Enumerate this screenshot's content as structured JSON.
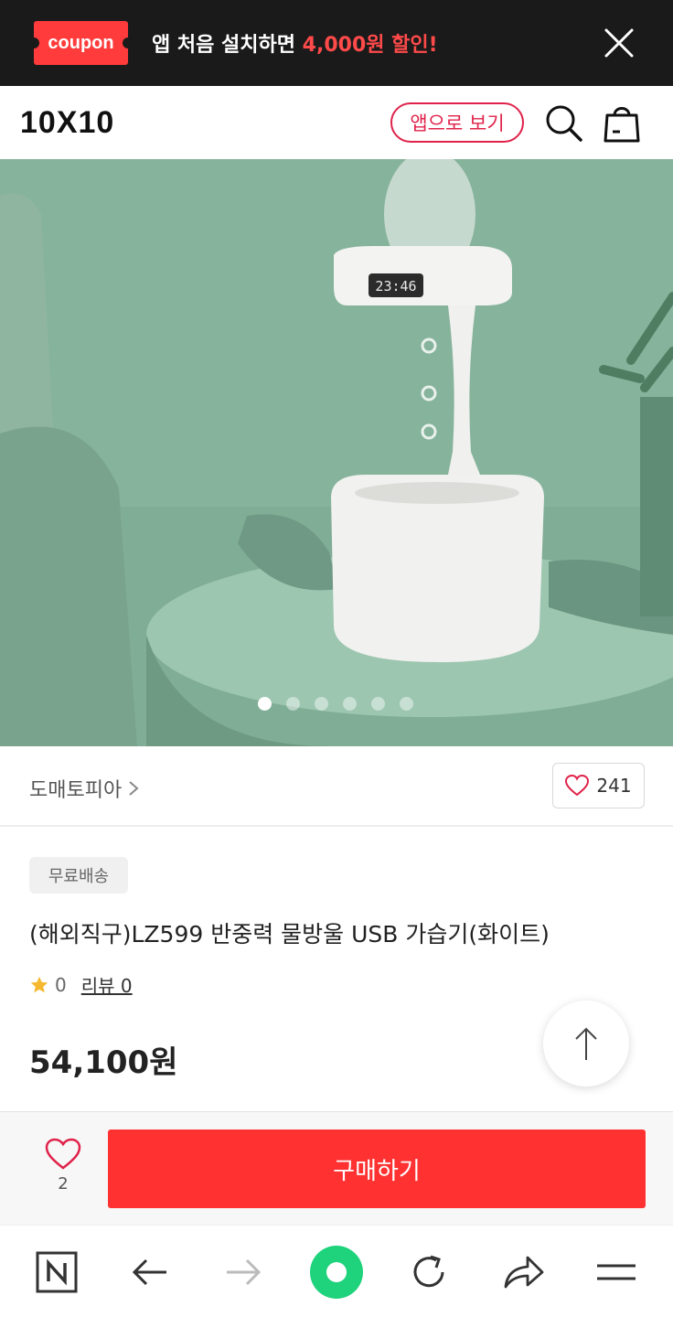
{
  "banner": {
    "coupon_label": "coupon",
    "text_prefix": "앱 처음 설치하면 ",
    "text_highlight": "4,000원 할인!"
  },
  "header": {
    "logo": "10X10",
    "app_button": "앱으로 보기"
  },
  "gallery": {
    "clock_display": "23:46",
    "dot_count": 6,
    "active_index": 0
  },
  "seller": {
    "name": "도매토피아",
    "like_count": "241"
  },
  "product": {
    "badge": "무료배송",
    "title": "(해외직구)LZ599 반중력 물방울 USB 가습기(화이트)",
    "rating": "0",
    "review_label": "리뷰 0",
    "price": "54,100원"
  },
  "purchase": {
    "wish_count": "2",
    "buy_label": "구매하기"
  },
  "colors": {
    "accent": "#ff3131",
    "banner_bg": "#1a1a1a",
    "app_pill": "#e0224a",
    "star": "#f5b82e"
  }
}
